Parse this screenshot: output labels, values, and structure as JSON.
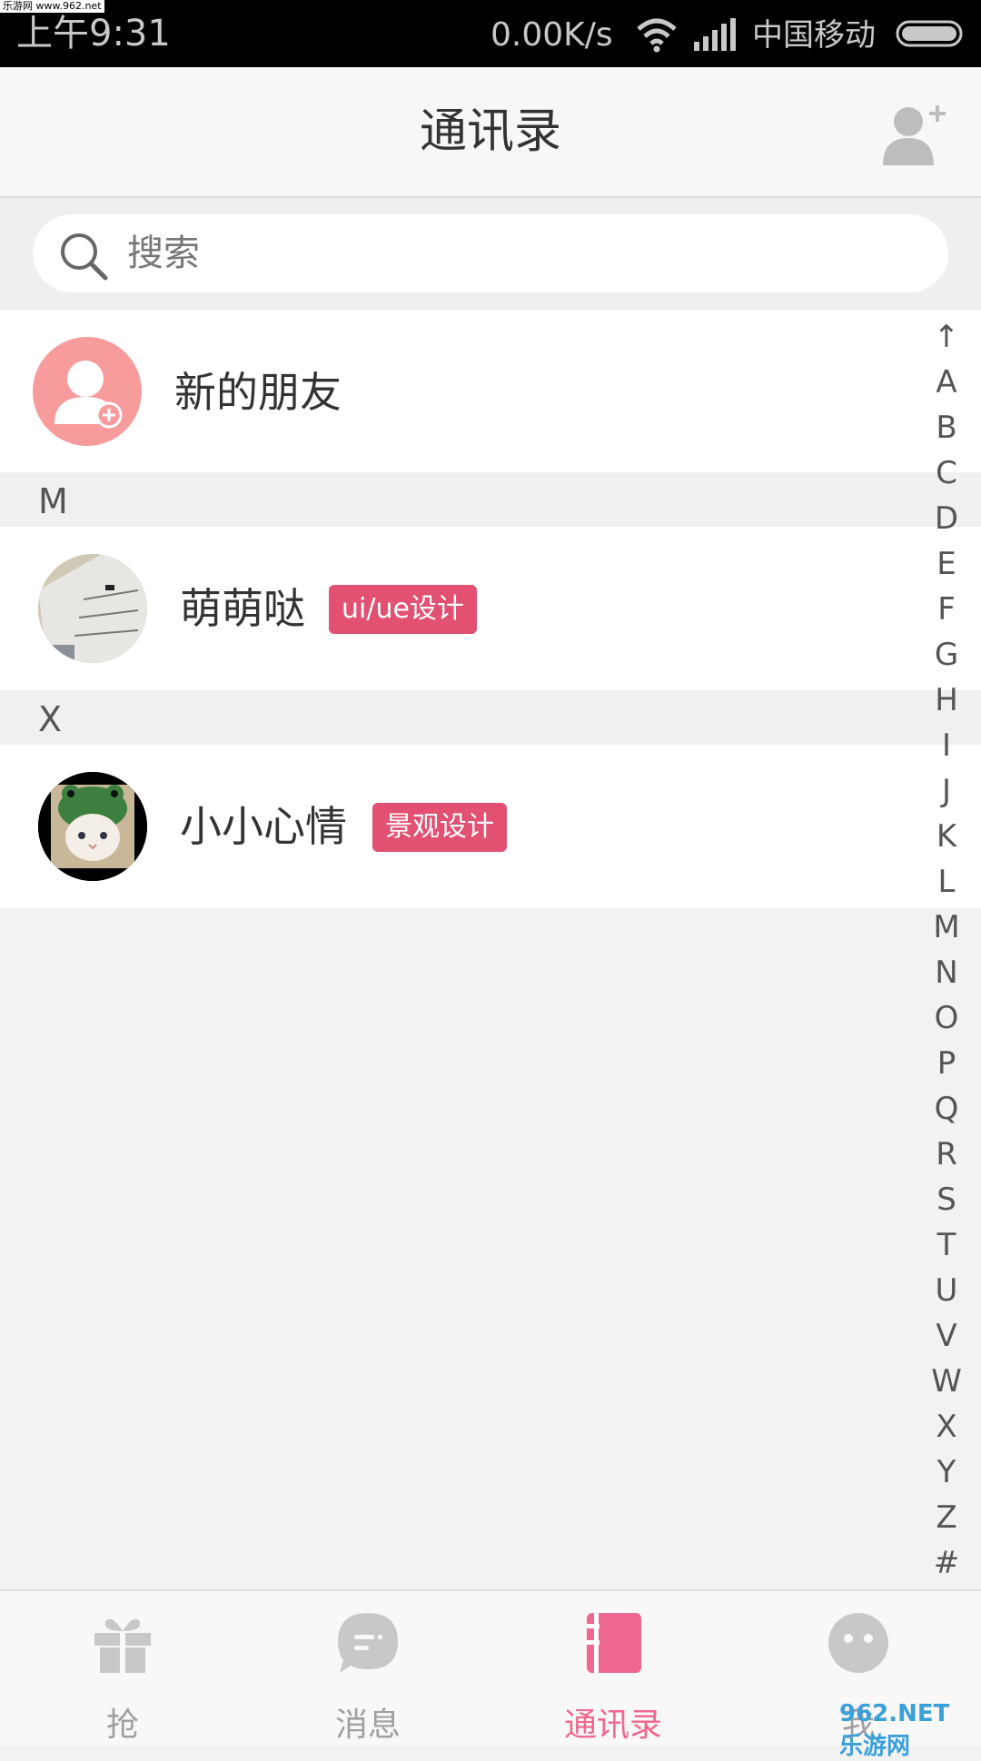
{
  "status_bar": {
    "watermark": "乐游网 www.962.net",
    "time": "上午9:31",
    "speed": "0.00K/s",
    "carrier": "中国移动"
  },
  "header": {
    "title": "通讯录",
    "add_icon": "add-contact-icon"
  },
  "search": {
    "placeholder": "搜索",
    "icon": "search-icon"
  },
  "new_friends": {
    "label": "新的朋友",
    "icon": "new-friend-icon",
    "color": "#f79b9d"
  },
  "sections": [
    {
      "letter": "M",
      "contacts": [
        {
          "name": "萌萌哒",
          "tag": "ui/ue设计"
        }
      ]
    },
    {
      "letter": "X",
      "contacts": [
        {
          "name": "小小心情",
          "tag": "景观设计"
        }
      ]
    }
  ],
  "index_bar": [
    "↑",
    "A",
    "B",
    "C",
    "D",
    "E",
    "F",
    "G",
    "H",
    "I",
    "J",
    "K",
    "L",
    "M",
    "N",
    "O",
    "P",
    "Q",
    "R",
    "S",
    "T",
    "U",
    "V",
    "W",
    "X",
    "Y",
    "Z",
    "#"
  ],
  "bottom_nav": [
    {
      "label": "抢",
      "icon": "gift-icon",
      "active": false
    },
    {
      "label": "消息",
      "icon": "message-icon",
      "active": false
    },
    {
      "label": "通讯录",
      "icon": "contacts-book-icon",
      "active": true
    },
    {
      "label": "我",
      "icon": "me-icon",
      "active": false
    }
  ],
  "bottom_watermark": "962.NET 乐游网",
  "colors": {
    "accent": "#f0688f",
    "tag": "#e25072",
    "inactive": "#c8c8c8"
  }
}
